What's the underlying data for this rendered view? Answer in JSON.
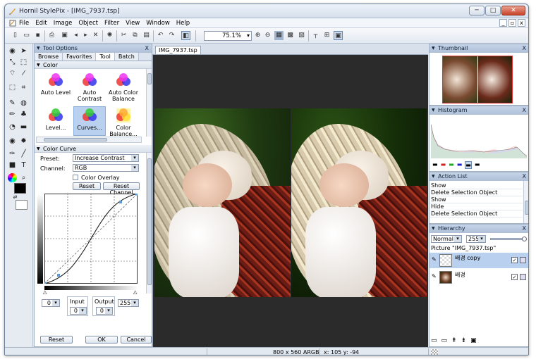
{
  "window": {
    "title": "Hornil StylePix - [IMG_7937.tsp]",
    "minimize": "─",
    "maximize": "□",
    "close": "✕"
  },
  "menu": {
    "items": [
      "File",
      "Edit",
      "Image",
      "Object",
      "Filter",
      "View",
      "Window",
      "Help"
    ],
    "mdi_min": "_",
    "mdi_restore": "▫",
    "mdi_close": "x"
  },
  "toolbar": {
    "zoom": "75.1%"
  },
  "tool_options": {
    "title": "Tool Options",
    "tabs": [
      "Browse",
      "Favorites",
      "Tool",
      "Batch"
    ],
    "active_tab": "Tool",
    "color_section": "Color",
    "effects": [
      {
        "label": "Auto Level",
        "icon": "auto-level-icon"
      },
      {
        "label": "Auto Contrast",
        "icon": "auto-contrast-icon"
      },
      {
        "label": "Auto Color Balance",
        "icon": "auto-color-balance-icon"
      },
      {
        "label": "Level...",
        "icon": "level-icon"
      },
      {
        "label": "Curves...",
        "icon": "curves-icon",
        "selected": true
      },
      {
        "label": "Color Balance...",
        "icon": "color-balance-icon"
      }
    ],
    "curve_section": "Color Curve",
    "preset_label": "Preset:",
    "preset_value": "Increase Contrast",
    "channel_label": "Channel:",
    "channel_value": "RGB",
    "overlay_label": "Color Overlay",
    "reset_label": "Reset",
    "reset_channel_label": "Reset Channel",
    "left_value": "0",
    "right_value": "255",
    "input_label": "Input",
    "input_value": "0",
    "output_label": "Output",
    "output_value": "0",
    "bottom_reset": "Reset",
    "ok": "OK",
    "cancel": "Cancel"
  },
  "document": {
    "tab": "IMG_7937.tsp"
  },
  "thumbnail": {
    "title": "Thumbnail"
  },
  "histogram": {
    "title": "Histogram"
  },
  "action_list": {
    "title": "Action List",
    "items": [
      "Show",
      "Delete Selection Object",
      "Show",
      "Hide",
      "Delete Selection Object"
    ]
  },
  "hierarchy": {
    "title": "Hierarchy",
    "blend_mode": "Normal",
    "opacity": "255",
    "picture": "Picture \"IMG_7937.tsp\"",
    "layers": [
      {
        "name": "배경 copy",
        "selected": true
      },
      {
        "name": "배경",
        "selected": false
      }
    ]
  },
  "status": {
    "size": "800 x 560 ARGB",
    "coords": "x: 105 y: -94"
  },
  "colors": {
    "accent": "#aebfd7",
    "selection": "#b9d1ee",
    "canvas": "#2b2b2b"
  }
}
